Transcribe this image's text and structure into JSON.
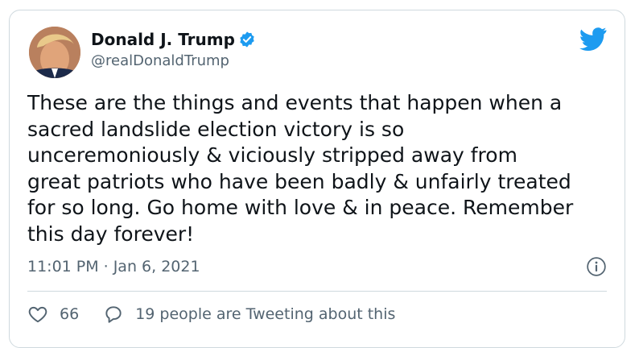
{
  "author": {
    "name": "Donald J. Trump",
    "handle": "@realDonaldTrump"
  },
  "tweet": {
    "text": "These are the things and events that happen when a\nsacred landslide election victory is so\nunceremoniously & viciously stripped away from\ngreat patriots who have been badly & unfairly treated\nfor so long. Go home with love & in peace. Remember\nthis day forever!",
    "time": "11:01 PM",
    "separator": "·",
    "date": "Jan 6, 2021"
  },
  "actions": {
    "likes": "66",
    "conversation": "19 people are Tweeting about this"
  },
  "icons": {
    "verified": "verified-badge-icon",
    "brand": "twitter-bird-icon",
    "info": "info-icon",
    "like": "heart-icon",
    "reply": "speech-bubble-icon"
  },
  "colors": {
    "brand": "#1d9bf0",
    "text": "#0f1419",
    "secondary": "#536471",
    "border": "#cfd9de"
  }
}
